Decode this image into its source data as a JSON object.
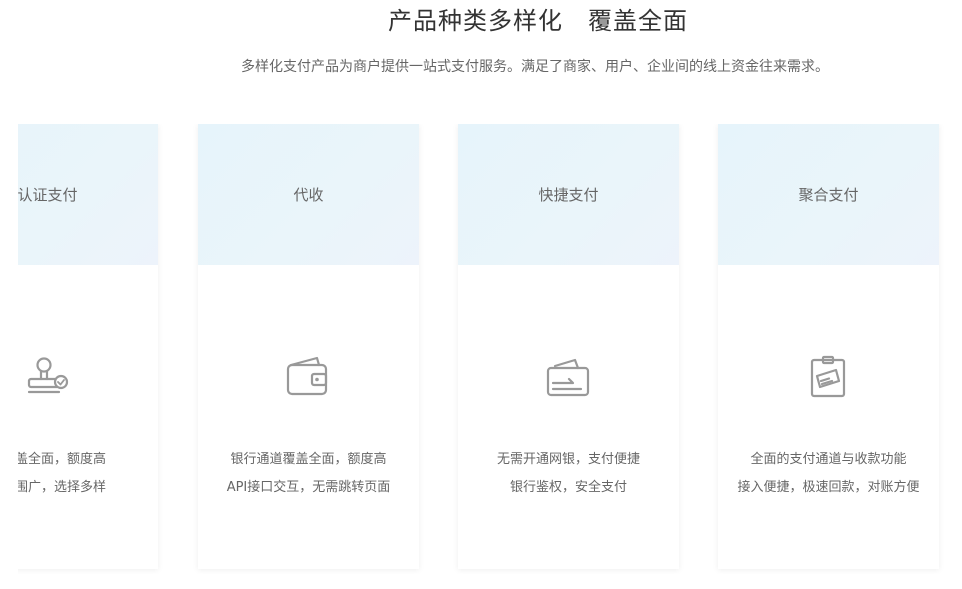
{
  "header": {
    "title": "产品种类多样化　覆盖全面",
    "subtitle": "多样化支付产品为商户提供一站式支付服务。满足了商家、用户、企业间的线上资金往来需求。"
  },
  "cards": [
    {
      "title": "认证支付",
      "icon": "stamp-check-icon",
      "lines": [
        "道覆盖全面，额度高",
        "付范围广，选择多样"
      ]
    },
    {
      "title": "代收",
      "icon": "wallet-icon",
      "lines": [
        "银行通道覆盖全面，额度高",
        "API接口交互，无需跳转页面"
      ]
    },
    {
      "title": "快捷支付",
      "icon": "card-icon",
      "lines": [
        "无需开通网银，支付便捷",
        "银行鉴权，安全支付"
      ]
    },
    {
      "title": "聚合支付",
      "icon": "clipboard-card-icon",
      "lines": [
        "全面的支付通道与收款功能",
        "接入便捷，极速回款，对账方便"
      ]
    }
  ]
}
